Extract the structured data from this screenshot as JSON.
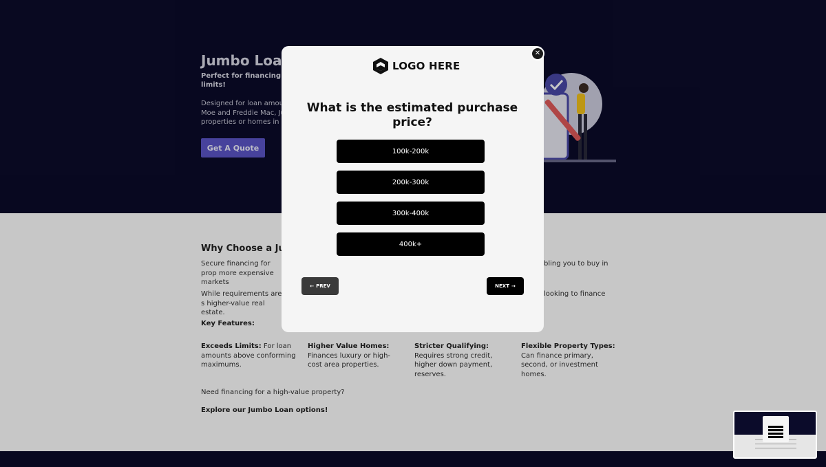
{
  "hero": {
    "title": "Jumbo Loan",
    "subtitle": "Perfect for financing hig limits!",
    "body": "Designed for loan amoun Moe and Freddie Mac, Ju properties or homes in h",
    "cta_label": "Get A Quote"
  },
  "content": {
    "title": "Why Choose a Jun",
    "para1_left": "Secure financing for prop more expensive markets",
    "para1_right": "bling you to buy in",
    "para2_left": "While requirements are s higher-value real estate.",
    "para2_right": "looking to finance",
    "key_features_label": "Key Features:",
    "features": [
      {
        "heading": "Exceeds Limits:",
        "text": " For loan amounts above conforming maximums."
      },
      {
        "heading": "Higher Value Homes:",
        "text": " Finances luxury or high-cost area properties."
      },
      {
        "heading": "Stricter Qualifying:",
        "text": " Requires strong credit, higher down payment, reserves."
      },
      {
        "heading": "Flexible Property Types:",
        "text": " Can finance primary, second, or investment homes."
      }
    ],
    "need_text": "Need financing for a high-value property?",
    "explore_text": "Explore our Jumbo Loan options!"
  },
  "modal": {
    "logo_text": "LOGO HERE",
    "question": "What is the estimated purchase price?",
    "options": [
      "100k-200k",
      "200k-300k",
      "300k-400k",
      "400k+"
    ],
    "prev_label": "PREV",
    "next_label": "NEXT",
    "close_icon": "close-icon"
  },
  "colors": {
    "hero_bg": "#0b0b2a",
    "cta": "#5b55c8",
    "modal_bg": "#f5f5f5",
    "option_bg": "#000000"
  }
}
